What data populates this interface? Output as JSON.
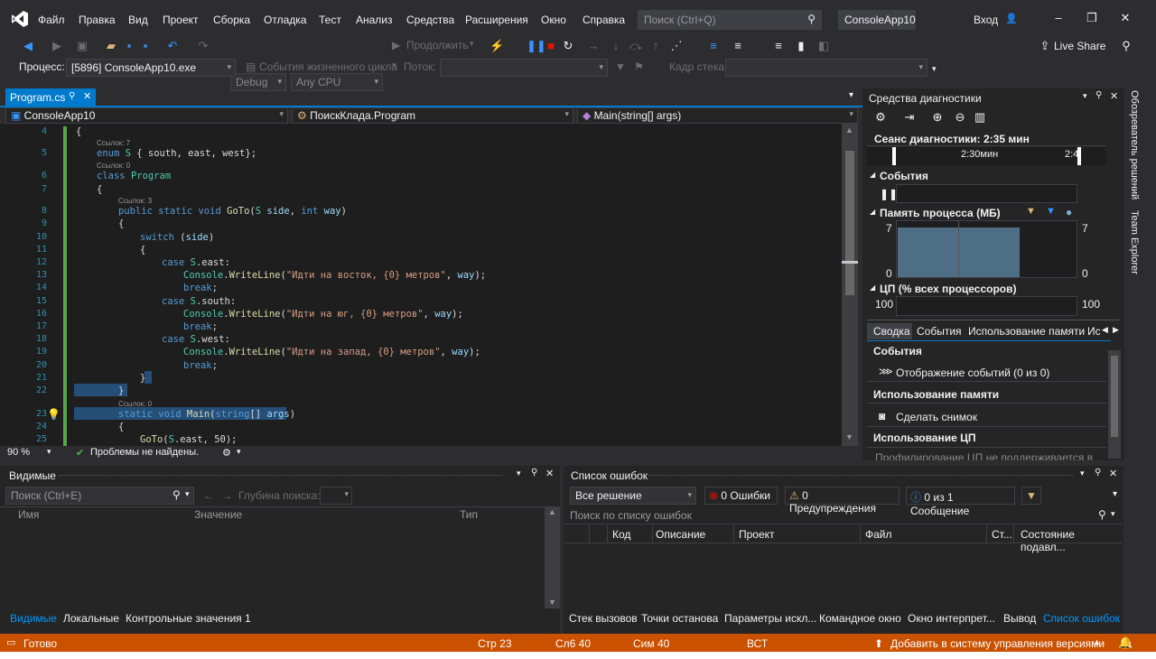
{
  "menu": {
    "items": [
      "Файл",
      "Правка",
      "Вид",
      "Проект",
      "Сборка",
      "Отладка",
      "Тест",
      "Анализ",
      "Средства",
      "Расширения",
      "Окно",
      "Справка"
    ],
    "search_placeholder": "Поиск (Ctrl+Q)",
    "project_name": "ConsoleApp10",
    "login": "Вход"
  },
  "toolbar": {
    "config": "Debug",
    "platform": "Any CPU",
    "continue": "Продолжить",
    "liveshare": "Live Share",
    "process_label": "Процесс:",
    "process_value": "[5896] ConsoleApp10.exe",
    "lifecycle": "События жизненного цикла",
    "thread_label": "Поток:",
    "stackframe_label": "Кадр стека:"
  },
  "editor": {
    "tab": "Program.cs",
    "nav_project": "ConsoleApp10",
    "nav_class": "ПоискКлада.Program",
    "nav_member": "Main(string[] args)",
    "zoom": "90 %",
    "status": "Проблемы не найдены.",
    "refs": {
      "r7": "Ссылок: 7",
      "r0a": "Ссылок: 0",
      "r3": "Ссылок: 3",
      "r0b": "Ссылок: 0"
    },
    "line_numbers": [
      "4",
      "5",
      "6",
      "7",
      "8",
      "9",
      "10",
      "11",
      "12",
      "13",
      "14",
      "15",
      "16",
      "17",
      "18",
      "19",
      "20",
      "21",
      "22",
      "23",
      "24",
      "25"
    ]
  },
  "diagnostics": {
    "title": "Средства диагностики",
    "session": "Сеанс диагностики: 2:35 мин",
    "ruler_mark1": "2:30мин",
    "ruler_mark2": "2:4",
    "events_label": "События",
    "memory_label": "Память процесса (МБ)",
    "memory_max": "7",
    "memory_min": "0",
    "cpu_label": "ЦП (% всех процессоров)",
    "cpu_max": "100",
    "tabs": [
      "Сводка",
      "События",
      "Использование памяти",
      "Ис"
    ],
    "sec_events": "События",
    "show_events": "Отображение событий (0 из 0)",
    "sec_memory": "Использование памяти",
    "snapshot": "Сделать снимок",
    "sec_cpu": "Использование ЦП",
    "cpu_note": "Профилирование ЦП не поддерживается в"
  },
  "side_tabs": [
    "Обозреватель решений",
    "Team Explorer"
  ],
  "watch": {
    "title": "Видимые",
    "search_placeholder": "Поиск (Ctrl+E)",
    "depth_label": "Глубина поиска:",
    "col_name": "Имя",
    "col_value": "Значение",
    "col_type": "Тип",
    "tabs": [
      "Видимые",
      "Локальные",
      "Контрольные значения 1"
    ]
  },
  "errors": {
    "title": "Список ошибок",
    "scope": "Все решение",
    "errors_btn": "0 Ошибки",
    "warnings_btn": "0 Предупреждения",
    "messages_btn": "0 из 1 Сообщение",
    "search_placeholder": "Поиск по списку ошибок",
    "cols": [
      "Код",
      "Описание",
      "Проект",
      "Файл",
      "Ст...",
      "Состояние подавл..."
    ],
    "tabs": [
      "Стек вызовов",
      "Точки останова",
      "Параметры искл...",
      "Командное окно",
      "Окно интерпрет...",
      "Вывод",
      "Список ошибок"
    ]
  },
  "status": {
    "ready": "Готово",
    "line": "Стр 23",
    "col": "Сл6 40",
    "char": "Сим 40",
    "mode": "ВСТ",
    "vcs": "Добавить в систему управления версиями",
    "notifications": "1"
  },
  "colors": {
    "accent": "#007acc",
    "status": "#ca5100"
  }
}
